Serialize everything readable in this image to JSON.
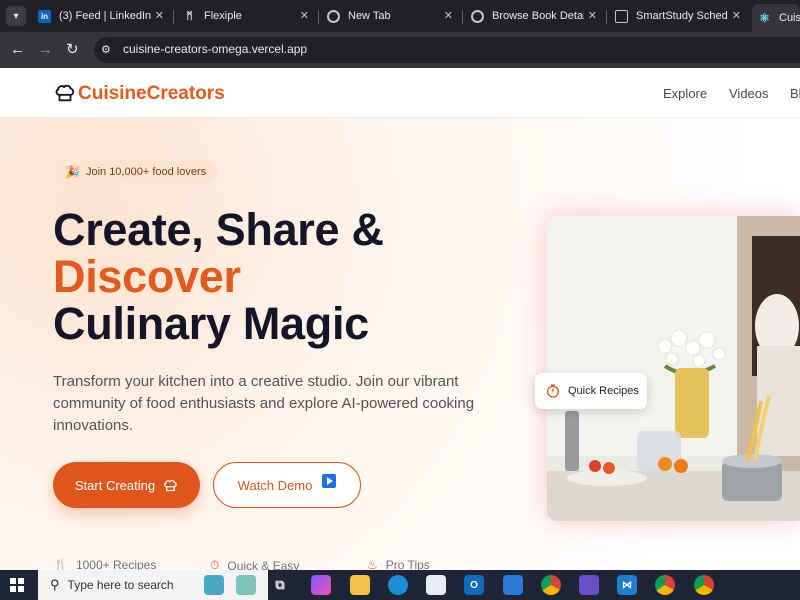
{
  "browser": {
    "tabs": [
      {
        "title": "(3) Feed | LinkedIn",
        "icon": "linkedin-icon"
      },
      {
        "title": "Flexiple",
        "icon": "flexiple-icon"
      },
      {
        "title": "New Tab",
        "icon": "chrome-icon"
      },
      {
        "title": "Browse Book Details",
        "icon": "browse-icon"
      },
      {
        "title": "SmartStudy Schedule",
        "icon": "book-icon"
      },
      {
        "title": "Cuisin",
        "icon": "react-icon"
      }
    ],
    "url": "cuisine-creators-omega.vercel.app"
  },
  "site": {
    "logo": "CuisineCreators",
    "nav": [
      "Explore",
      "Videos",
      "Bl"
    ]
  },
  "hero": {
    "badge": "Join 10,000+ food lovers",
    "headline_line1": "Create, Share &",
    "headline_accent": "Discover",
    "headline_line3": "Culinary Magic",
    "description": "Transform your kitchen into a creative studio. Join our vibrant community of food enthusiasts and explore AI-powered cooking innovations.",
    "primary_button": "Start Creating",
    "secondary_button": "Watch Demo",
    "quick_card": "Quick Recipes",
    "stats": [
      "1000+ Recipes",
      "Quick & Easy",
      "Pro Tips"
    ]
  },
  "taskbar": {
    "search_placeholder": "Type here to search"
  },
  "colors": {
    "brand": "#e0561a",
    "heading": "#141528",
    "tab_strip": "#202124"
  }
}
